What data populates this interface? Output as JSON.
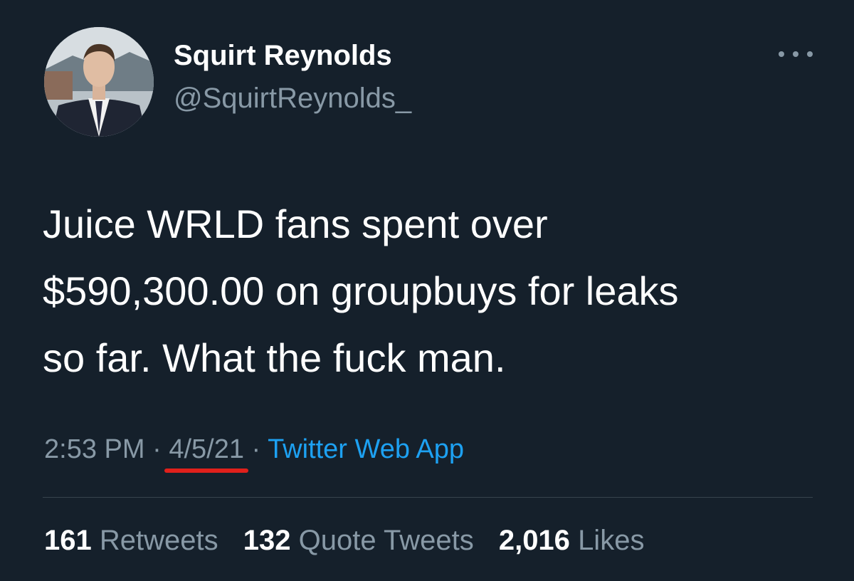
{
  "user": {
    "display_name": "Squirt Reynolds",
    "handle": "@SquirtReynolds_"
  },
  "tweet": {
    "lines": [
      "Juice WRLD fans spent over",
      "$590,300.00 on groupbuys for leaks",
      "so far. What the fuck man."
    ]
  },
  "meta": {
    "time": "2:53 PM",
    "separator": "·",
    "date": "4/5/21",
    "source": "Twitter Web App"
  },
  "stats": {
    "retweets": {
      "count": "161",
      "label": "Retweets"
    },
    "quotes": {
      "count": "132",
      "label": "Quote Tweets"
    },
    "likes": {
      "count": "2,016",
      "label": "Likes"
    }
  },
  "colors": {
    "background": "#15202b",
    "secondary_text": "#8899a6",
    "link": "#1da1f2",
    "annotation_underline": "#e0201b"
  },
  "icons": {
    "more": "more-horizontal-icon"
  }
}
